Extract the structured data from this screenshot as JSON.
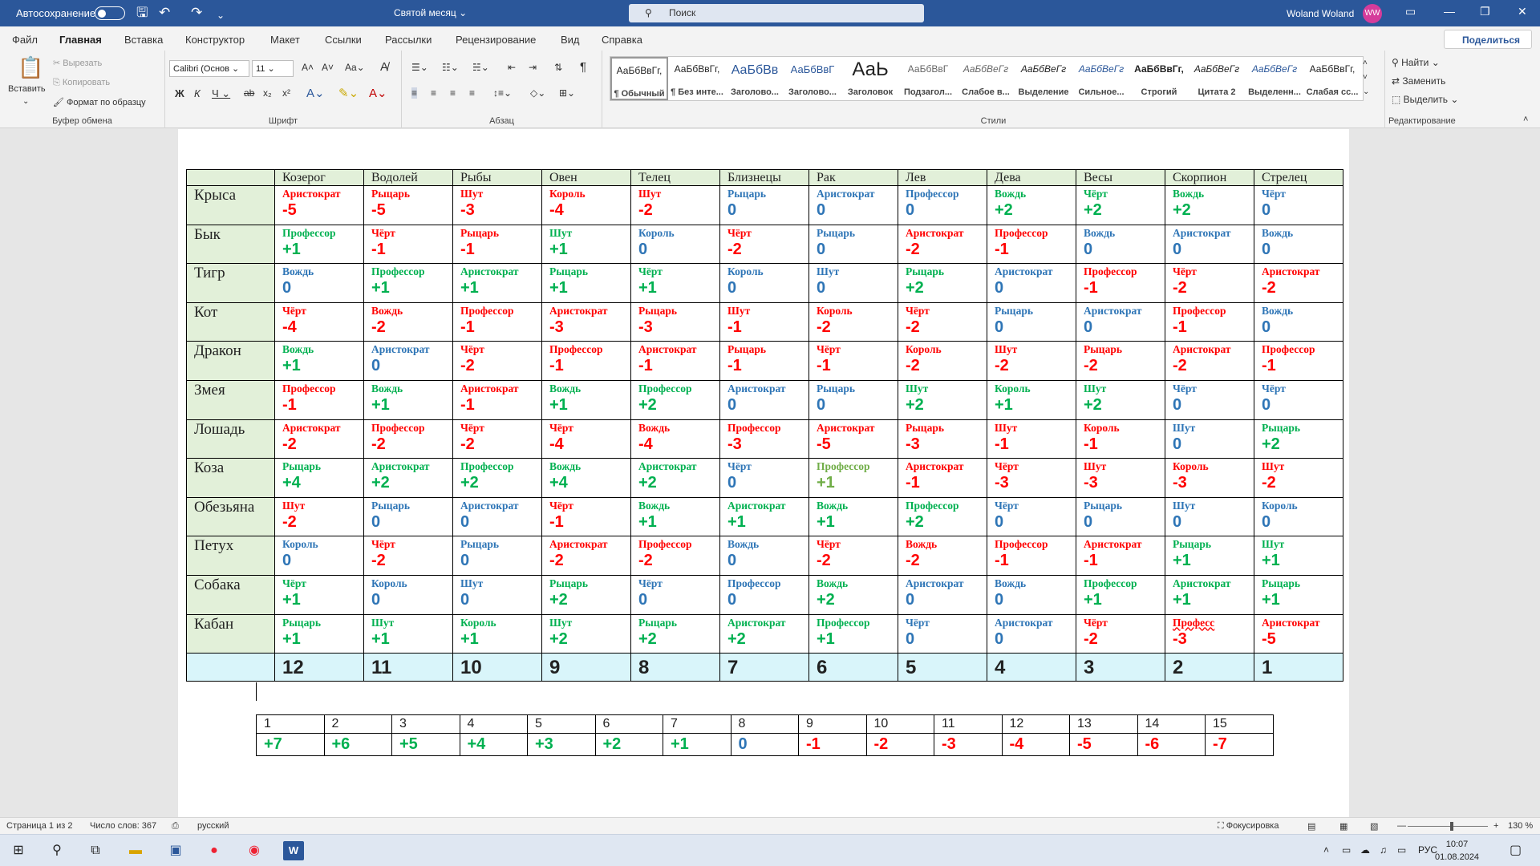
{
  "window": {
    "autosave_label": "Автосохранение",
    "doc_title": "Святой месяц",
    "search_placeholder": "Поиск",
    "user_name": "Woland Woland",
    "user_initials": "WW"
  },
  "tabs": [
    "Файл",
    "Главная",
    "Вставка",
    "Конструктор",
    "Макет",
    "Ссылки",
    "Рассылки",
    "Рецензирование",
    "Вид",
    "Справка"
  ],
  "share_label": "Поделиться",
  "ribbon": {
    "clipboard": {
      "label": "Буфер обмена",
      "paste": "Вставить",
      "cut": "Вырезать",
      "copy": "Копировать",
      "format_painter": "Формат по образцу"
    },
    "font": {
      "label": "Шрифт",
      "font_name": "Calibri (Основ",
      "font_size": "11"
    },
    "paragraph": {
      "label": "Абзац"
    },
    "styles": {
      "label": "Стили",
      "items": [
        {
          "preview": "АаБбВвГг,",
          "name": "¶ Обычный"
        },
        {
          "preview": "АаБбВвГг,",
          "name": "¶ Без инте..."
        },
        {
          "preview": "АаБбВв",
          "name": "Заголово..."
        },
        {
          "preview": "АаБбВвГ",
          "name": "Заголово..."
        },
        {
          "preview": "АаЬ",
          "name": "Заголовок"
        },
        {
          "preview": "АаБбВвГ",
          "name": "Подзагол..."
        },
        {
          "preview": "АаБбВеГг",
          "name": "Слабое в..."
        },
        {
          "preview": "АаБбВеГг",
          "name": "Выделение"
        },
        {
          "preview": "АаБбВеГг",
          "name": "Сильное..."
        },
        {
          "preview": "АаБбВвГг,",
          "name": "Строгий"
        },
        {
          "preview": "АаБбВеГг",
          "name": "Цитата 2"
        },
        {
          "preview": "АаБбВеГг",
          "name": "Выделенн..."
        },
        {
          "preview": "АаБбВвГг,",
          "name": "Слабая сс..."
        }
      ]
    },
    "editing": {
      "label": "Редактирование",
      "find": "Найти",
      "replace": "Заменить",
      "select": "Выделить"
    }
  },
  "colors": {
    "red": "#ff0000",
    "blue": "#2e75b6",
    "green": "#00b050",
    "lime": "#70ad47",
    "header_green": "#e2f0d9",
    "footer_cyan": "#d9f5fa",
    "word_blue": "#2b579a"
  },
  "zodiac_table": {
    "columns": [
      "Козерог",
      "Водолей",
      "Рыбы",
      "Овен",
      "Телец",
      "Близнецы",
      "Рак",
      "Лев",
      "Дева",
      "Весы",
      "Скорпион",
      "Стрелец"
    ],
    "rows": [
      {
        "name": "Крыса",
        "cells": [
          [
            "Аристократ",
            "-5",
            "r"
          ],
          [
            "Рыцарь",
            "-5",
            "r"
          ],
          [
            "Шут",
            "-3",
            "r"
          ],
          [
            "Король",
            "-4",
            "r"
          ],
          [
            "Шут",
            "-2",
            "r"
          ],
          [
            "Рыцарь",
            "0",
            "b"
          ],
          [
            "Аристократ",
            "0",
            "b"
          ],
          [
            "Профессор",
            "0",
            "b"
          ],
          [
            "Вождь",
            "+2",
            "g"
          ],
          [
            "Чёрт",
            "+2",
            "g"
          ],
          [
            "Вождь",
            "+2",
            "g"
          ],
          [
            "Чёрт",
            "0",
            "b"
          ]
        ]
      },
      {
        "name": "Бык",
        "cells": [
          [
            "Профессор",
            "+1",
            "g"
          ],
          [
            "Чёрт",
            "-1",
            "r"
          ],
          [
            "Рыцарь",
            "-1",
            "r"
          ],
          [
            "Шут",
            "+1",
            "g"
          ],
          [
            "Король",
            "0",
            "b"
          ],
          [
            "Чёрт",
            "-2",
            "r"
          ],
          [
            "Рыцарь",
            "0",
            "b"
          ],
          [
            "Аристократ",
            "-2",
            "r"
          ],
          [
            "Профессор",
            "-1",
            "r"
          ],
          [
            "Вождь",
            "0",
            "b"
          ],
          [
            "Аристократ",
            "0",
            "b"
          ],
          [
            "Вождь",
            "0",
            "b"
          ]
        ]
      },
      {
        "name": "Тигр",
        "cells": [
          [
            "Вождь",
            "0",
            "b"
          ],
          [
            "Профессор",
            "+1",
            "g"
          ],
          [
            "Аристократ",
            "+1",
            "g"
          ],
          [
            "Рыцарь",
            "+1",
            "g"
          ],
          [
            "Чёрт",
            "+1",
            "g"
          ],
          [
            "Король",
            "0",
            "b"
          ],
          [
            "Шут",
            "0",
            "b"
          ],
          [
            "Рыцарь",
            "+2",
            "g"
          ],
          [
            "Аристократ",
            "0",
            "b"
          ],
          [
            "Профессор",
            "-1",
            "r"
          ],
          [
            "Чёрт",
            "-2",
            "r"
          ],
          [
            "Аристократ",
            "-2",
            "r"
          ]
        ]
      },
      {
        "name": "Кот",
        "cells": [
          [
            "Чёрт",
            "-4",
            "r"
          ],
          [
            "Вождь",
            "-2",
            "r"
          ],
          [
            "Профессор",
            "-1",
            "r"
          ],
          [
            "Аристократ",
            "-3",
            "r"
          ],
          [
            "Рыцарь",
            "-3",
            "r"
          ],
          [
            "Шут",
            "-1",
            "r"
          ],
          [
            "Король",
            "-2",
            "r"
          ],
          [
            "Чёрт",
            "-2",
            "r"
          ],
          [
            "Рыцарь",
            "0",
            "b"
          ],
          [
            "Аристократ",
            "0",
            "b"
          ],
          [
            "Профессор",
            "-1",
            "r"
          ],
          [
            "Вождь",
            "0",
            "b"
          ]
        ]
      },
      {
        "name": "Дракон",
        "cells": [
          [
            "Вождь",
            "+1",
            "g"
          ],
          [
            "Аристократ",
            "0",
            "b"
          ],
          [
            "Чёрт",
            "-2",
            "r"
          ],
          [
            "Профессор",
            "-1",
            "r"
          ],
          [
            "Аристократ",
            "-1",
            "r"
          ],
          [
            "Рыцарь",
            "-1",
            "r"
          ],
          [
            "Чёрт",
            "-1",
            "r"
          ],
          [
            "Король",
            "-2",
            "r"
          ],
          [
            "Шут",
            "-2",
            "r"
          ],
          [
            "Рыцарь",
            "-2",
            "r"
          ],
          [
            "Аристократ",
            "-2",
            "r"
          ],
          [
            "Профессор",
            "-1",
            "r"
          ]
        ]
      },
      {
        "name": "Змея",
        "cells": [
          [
            "Профессор",
            "-1",
            "r"
          ],
          [
            "Вождь",
            "+1",
            "g"
          ],
          [
            "Аристократ",
            "-1",
            "r"
          ],
          [
            "Вождь",
            "+1",
            "g"
          ],
          [
            "Профессор",
            "+2",
            "g"
          ],
          [
            "Аристократ",
            "0",
            "b"
          ],
          [
            "Рыцарь",
            "0",
            "b"
          ],
          [
            "Шут",
            "+2",
            "g"
          ],
          [
            "Король",
            "+1",
            "g"
          ],
          [
            "Шут",
            "+2",
            "g"
          ],
          [
            "Чёрт",
            "0",
            "b"
          ],
          [
            "Чёрт",
            "0",
            "b"
          ]
        ]
      },
      {
        "name": "Лошадь",
        "cells": [
          [
            "Аристократ",
            "-2",
            "r"
          ],
          [
            "Профессор",
            "-2",
            "r"
          ],
          [
            "Чёрт",
            "-2",
            "r"
          ],
          [
            "Чёрт",
            "-4",
            "r"
          ],
          [
            "Вождь",
            "-4",
            "r"
          ],
          [
            "Профессор",
            "-3",
            "r"
          ],
          [
            "Аристократ",
            "-5",
            "r"
          ],
          [
            "Рыцарь",
            "-3",
            "r"
          ],
          [
            "Шут",
            "-1",
            "r"
          ],
          [
            "Король",
            "-1",
            "r"
          ],
          [
            "Шут",
            "0",
            "b"
          ],
          [
            "Рыцарь",
            "+2",
            "g"
          ]
        ]
      },
      {
        "name": "Коза",
        "cells": [
          [
            "Рыцарь",
            "+4",
            "g"
          ],
          [
            "Аристократ",
            "+2",
            "g"
          ],
          [
            "Профессор",
            "+2",
            "g"
          ],
          [
            "Вождь",
            "+4",
            "g"
          ],
          [
            "Аристократ",
            "+2",
            "g"
          ],
          [
            "Чёрт",
            "0",
            "b"
          ],
          [
            "Профессор",
            "+1",
            "l"
          ],
          [
            "Аристократ",
            "-1",
            "r"
          ],
          [
            "Чёрт",
            "-3",
            "r"
          ],
          [
            "Шут",
            "-3",
            "r"
          ],
          [
            "Король",
            "-3",
            "r"
          ],
          [
            "Шут",
            "-2",
            "r"
          ]
        ]
      },
      {
        "name": "Обезьяна",
        "cells": [
          [
            "Шут",
            "-2",
            "r"
          ],
          [
            "Рыцарь",
            "0",
            "b"
          ],
          [
            "Аристократ",
            "0",
            "b"
          ],
          [
            "Чёрт",
            "-1",
            "r"
          ],
          [
            "Вождь",
            "+1",
            "g"
          ],
          [
            "Аристократ",
            "+1",
            "g"
          ],
          [
            "Вождь",
            "+1",
            "g"
          ],
          [
            "Профессор",
            "+2",
            "g"
          ],
          [
            "Чёрт",
            "0",
            "b"
          ],
          [
            "Рыцарь",
            "0",
            "b"
          ],
          [
            "Шут",
            "0",
            "b"
          ],
          [
            "Король",
            "0",
            "b"
          ]
        ]
      },
      {
        "name": "Петух",
        "cells": [
          [
            "Король",
            "0",
            "b"
          ],
          [
            "Чёрт",
            "-2",
            "r"
          ],
          [
            "Рыцарь",
            "0",
            "b"
          ],
          [
            "Аристократ",
            "-2",
            "r"
          ],
          [
            "Профессор",
            "-2",
            "r"
          ],
          [
            "Вождь",
            "0",
            "b"
          ],
          [
            "Чёрт",
            "-2",
            "r"
          ],
          [
            "Вождь",
            "-2",
            "r"
          ],
          [
            "Профессор",
            "-1",
            "r"
          ],
          [
            "Аристократ",
            "-1",
            "r"
          ],
          [
            "Рыцарь",
            "+1",
            "g"
          ],
          [
            "Шут",
            "+1",
            "g"
          ]
        ]
      },
      {
        "name": "Собака",
        "cells": [
          [
            "Чёрт",
            "+1",
            "g"
          ],
          [
            "Король",
            "0",
            "b"
          ],
          [
            "Шут",
            "0",
            "b"
          ],
          [
            "Рыцарь",
            "+2",
            "g"
          ],
          [
            "Чёрт",
            "0",
            "b"
          ],
          [
            "Профессор",
            "0",
            "b"
          ],
          [
            "Вождь",
            "+2",
            "g"
          ],
          [
            "Аристократ",
            "0",
            "b"
          ],
          [
            "Вождь",
            "0",
            "b"
          ],
          [
            "Профессор",
            "+1",
            "g"
          ],
          [
            "Аристократ",
            "+1",
            "g"
          ],
          [
            "Рыцарь",
            "+1",
            "g"
          ]
        ]
      },
      {
        "name": "Кабан",
        "cells": [
          [
            "Рыцарь",
            "+1",
            "g"
          ],
          [
            "Шут",
            "+1",
            "g"
          ],
          [
            "Король",
            "+1",
            "g"
          ],
          [
            "Шут",
            "+2",
            "g"
          ],
          [
            "Рыцарь",
            "+2",
            "g"
          ],
          [
            "Аристократ",
            "+2",
            "g"
          ],
          [
            "Профессор",
            "+1",
            "g"
          ],
          [
            "Чёрт",
            "0",
            "b"
          ],
          [
            "Аристократ",
            "0",
            "b"
          ],
          [
            "Чёрт",
            "-2",
            "r"
          ],
          [
            "Професс",
            "-3",
            "r"
          ],
          [
            "Аристократ",
            "-5",
            "r"
          ]
        ]
      }
    ],
    "footer": [
      "12",
      "11",
      "10",
      "9",
      "8",
      "7",
      "6",
      "5",
      "4",
      "3",
      "2",
      "1"
    ]
  },
  "scale_table": {
    "numbers": [
      "1",
      "2",
      "3",
      "4",
      "5",
      "6",
      "7",
      "8",
      "9",
      "10",
      "11",
      "12",
      "13",
      "14",
      "15"
    ],
    "values": [
      [
        "+7",
        "g"
      ],
      [
        "+6",
        "g"
      ],
      [
        "+5",
        "g"
      ],
      [
        "+4",
        "g"
      ],
      [
        "+3",
        "g"
      ],
      [
        "+2",
        "g"
      ],
      [
        "+1",
        "g"
      ],
      [
        "0",
        "b"
      ],
      [
        "-1",
        "r"
      ],
      [
        "-2",
        "r"
      ],
      [
        "-3",
        "r"
      ],
      [
        "-4",
        "r"
      ],
      [
        "-5",
        "r"
      ],
      [
        "-6",
        "r"
      ],
      [
        "-7",
        "r"
      ]
    ]
  },
  "statusbar": {
    "page": "Страница 1 из 2",
    "words": "Число слов: 367",
    "language": "русский",
    "focus": "Фокусировка",
    "zoom": "130 %"
  },
  "taskbar": {
    "lang": "РУС",
    "time": "10:07",
    "date": "01.08.2024"
  }
}
